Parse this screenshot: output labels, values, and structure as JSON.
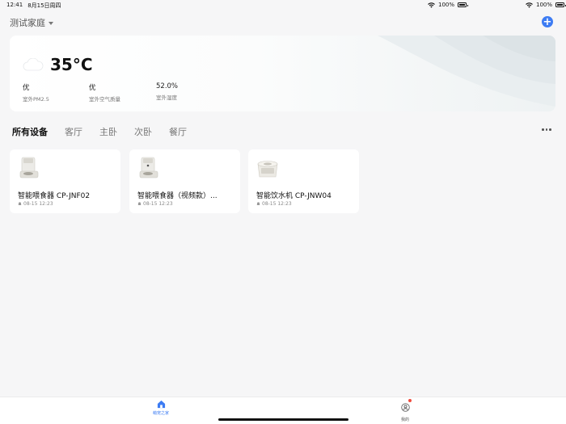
{
  "status_bar": {
    "time": "12:41",
    "date": "8月15日周四",
    "battery_mid": "100%",
    "battery_right": "100%"
  },
  "header": {
    "home_name": "测试家庭"
  },
  "weather": {
    "temperature": "35°C",
    "stats": [
      {
        "value": "优",
        "label": "室外PM2.5"
      },
      {
        "value": "优",
        "label": "室外空气质量"
      },
      {
        "value": "52.0%",
        "label": "室外湿度"
      }
    ]
  },
  "tabs": [
    "所有设备",
    "客厅",
    "主卧",
    "次卧",
    "餐厅"
  ],
  "devices": [
    {
      "name": "智能喂食器 CP-JNF02",
      "time": "08-15 12:23",
      "icon": "pet-feeder-icon"
    },
    {
      "name": "智能喂食器（视频款）...",
      "time": "08-15 12:23",
      "icon": "pet-feeder-icon"
    },
    {
      "name": "智能饮水机 CP-JNW04",
      "time": "08-15 12:23",
      "icon": "water-fountain-icon"
    }
  ],
  "bottom_nav": {
    "home_label": "萌宠之家",
    "me_label": "我的"
  },
  "colors": {
    "accent": "#3d7cf3",
    "badge": "#f04a3c"
  }
}
